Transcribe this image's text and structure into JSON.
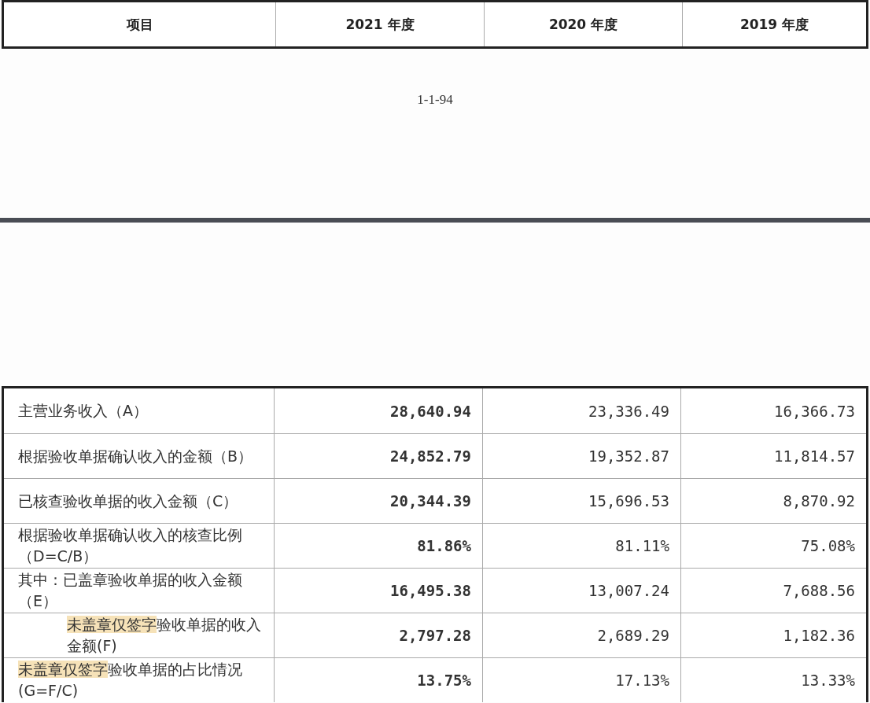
{
  "header_table": {
    "columns": [
      "项目",
      "2021 年度",
      "2020 年度",
      "2019 年度"
    ]
  },
  "page_footer": {
    "page_number": "1-1-94"
  },
  "table": {
    "rows": [
      {
        "label": [
          {
            "text": "主营业务收入（A）",
            "highlighted": false
          }
        ],
        "indented": false,
        "values": [
          "28,640.94",
          "23,336.49",
          "16,366.73"
        ]
      },
      {
        "label": [
          {
            "text": "根据验收单据确认收入的金额（B）",
            "highlighted": false
          }
        ],
        "indented": false,
        "values": [
          "24,852.79",
          "19,352.87",
          "11,814.57"
        ]
      },
      {
        "label": [
          {
            "text": "已核查验收单据的收入金额（C）",
            "highlighted": false
          }
        ],
        "indented": false,
        "values": [
          "20,344.39",
          "15,696.53",
          "8,870.92"
        ]
      },
      {
        "label": [
          {
            "text": "根据验收单据确认收入的核查比例（D=C/B）",
            "highlighted": false
          }
        ],
        "indented": false,
        "values": [
          "81.86%",
          "81.11%",
          "75.08%"
        ]
      },
      {
        "label": [
          {
            "text": "其中：已盖章验收单据的收入金额（E）",
            "highlighted": false
          }
        ],
        "indented": false,
        "values": [
          "16,495.38",
          "13,007.24",
          "7,688.56"
        ]
      },
      {
        "label": [
          {
            "text": "未盖章仅签字",
            "highlighted": true
          },
          {
            "text": "验收单据的收入金额(F)",
            "highlighted": false
          }
        ],
        "indented": true,
        "values": [
          "2,797.28",
          "2,689.29",
          "1,182.36"
        ]
      },
      {
        "label": [
          {
            "text": "未盖章仅签字",
            "highlighted": true
          },
          {
            "text": "验收单据的占比情况(G=F/C)",
            "highlighted": false
          }
        ],
        "indented": false,
        "values": [
          "13.75%",
          "17.13%",
          "13.33%"
        ]
      }
    ]
  }
}
